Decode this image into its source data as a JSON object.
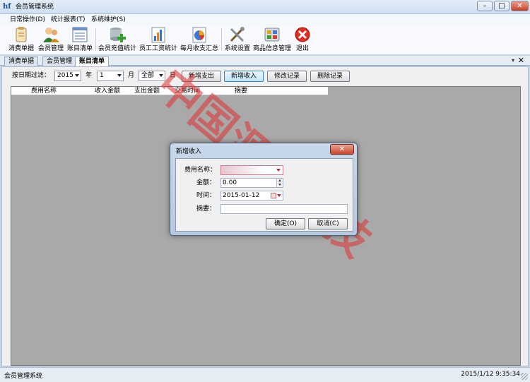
{
  "window": {
    "title": "会员管理系统",
    "logo": "hf",
    "min": "–",
    "max": "□",
    "close": "✕"
  },
  "menu": [
    {
      "label": "日常操作(D)"
    },
    {
      "label": "统计报表(T)"
    },
    {
      "label": "系统维护(S)"
    }
  ],
  "toolbar": [
    {
      "label": "消费单据",
      "icon": "receipt-icon"
    },
    {
      "label": "会员管理",
      "icon": "members-icon"
    },
    {
      "label": "账目清单",
      "icon": "ledger-icon"
    },
    {
      "label": "会员充值统计",
      "icon": "database-add-icon"
    },
    {
      "label": "员工工资统计",
      "icon": "bar-chart-icon"
    },
    {
      "label": "每月收支汇总",
      "icon": "pie-chart-icon"
    },
    {
      "label": "系统设置",
      "icon": "tools-icon"
    },
    {
      "label": "商品信息管理",
      "icon": "goods-icon"
    },
    {
      "label": "退出",
      "icon": "exit-icon"
    }
  ],
  "tabs": [
    {
      "label": "消费单据"
    },
    {
      "label": "会员管理"
    },
    {
      "label": "账目清单"
    }
  ],
  "tab_controls": {
    "arrow": "▾",
    "close": "✕"
  },
  "filter": {
    "label": "按日期过滤：",
    "year": "2015",
    "year_unit": "年",
    "month": "1",
    "month_unit": "月",
    "day": "全部",
    "day_unit": "日",
    "buttons": [
      "新增支出",
      "新增收入",
      "修改记录",
      "删除记录"
    ]
  },
  "grid": {
    "columns": [
      "费用名称",
      "收入金额",
      "支出金额",
      "交易时间",
      "摘要"
    ]
  },
  "dialog": {
    "title": "新增收入",
    "close": "✕",
    "fields": {
      "category_label": "费用名称：",
      "category_value": "",
      "amount_label": "金额：",
      "amount_value": "0.00",
      "time_label": "时间：",
      "time_value": "2015-01-12",
      "memo_label": "摘要：",
      "memo_value": ""
    },
    "ok": "确定(O)",
    "cancel": "取消(C)"
  },
  "status": {
    "left": "会员管理系统",
    "right": "2015/1/12 9:35:34"
  },
  "watermark": {
    "text": "中国源码科技",
    "color": "#e03030"
  }
}
